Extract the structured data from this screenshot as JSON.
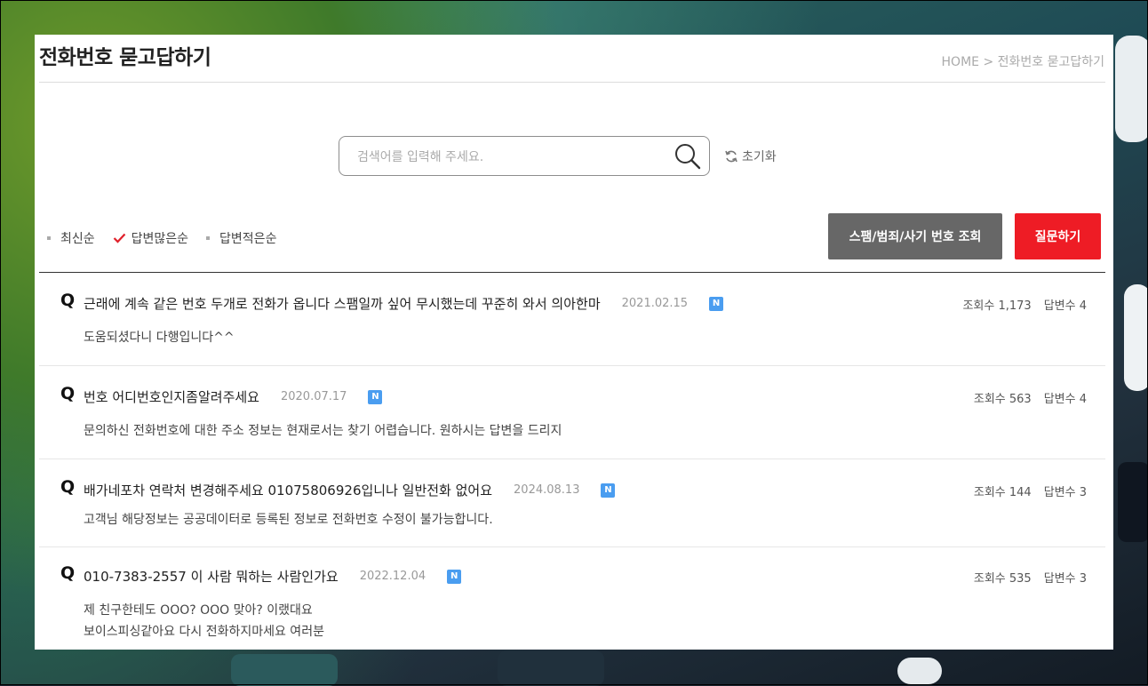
{
  "page": {
    "title": "전화번호 묻고답하기",
    "breadcrumb": "HOME > 전화번호 묻고답하기"
  },
  "search": {
    "placeholder": "검색어를 입력해 주세요.",
    "value": "",
    "reset_label": "초기화"
  },
  "sort": [
    {
      "label": "최신순",
      "selected": false
    },
    {
      "label": "답변많은순",
      "selected": true
    },
    {
      "label": "답변적은순",
      "selected": false
    }
  ],
  "buttons": {
    "spam_lookup": "스팸/범죄/사기 번호 조회",
    "ask": "질문하기"
  },
  "qa_list": [
    {
      "q_marker": "Q",
      "title": "근래에 계속 같은 번호 두개로 전화가 옵니다 스팸일까 싶어 무시했는데 꾸준히 와서 의아한마",
      "date": "2021.02.15",
      "badge": "N",
      "views": "조회수 1,173",
      "answers": "답변수 4",
      "answer_lines": [
        "도움되셨다니 다행입니다^^"
      ]
    },
    {
      "q_marker": "Q",
      "title": "번호 어디번호인지좀알려주세요",
      "date": "2020.07.17",
      "badge": "N",
      "views": "조회수 563",
      "answers": "답변수 4",
      "answer_lines": [
        "문의하신 전화번호에 대한 주소 정보는 현재로서는 찾기 어렵습니다. 원하시는 답변을 드리지"
      ]
    },
    {
      "q_marker": "Q",
      "title": "배가네포차 연락처 변경해주세요 01075806926입니나 일반전화 없어요",
      "date": "2024.08.13",
      "badge": "N",
      "views": "조회수 144",
      "answers": "답변수 3",
      "answer_lines": [
        "고객님 해당정보는 공공데이터로 등록된 정보로 전화번호 수정이 불가능합니다."
      ]
    },
    {
      "q_marker": "Q",
      "title": "010-7383-2557 이 사람 뭐하는 사람인가요",
      "date": "2022.12.04",
      "badge": "N",
      "views": "조회수 535",
      "answers": "답변수 3",
      "answer_lines": [
        "제 친구한테도 OOO? OOO 맞아? 이랬대요",
        "보이스피싱같아요 다시 전화하지마세요 여러분"
      ]
    }
  ],
  "colors": {
    "accent_red": "#ee1c25",
    "button_gray": "#676767",
    "badge_blue": "#4a9df0",
    "check_red": "#e0202a"
  },
  "icons": {
    "search": "search-icon",
    "reset": "refresh-icon",
    "check": "checkmark-icon"
  }
}
